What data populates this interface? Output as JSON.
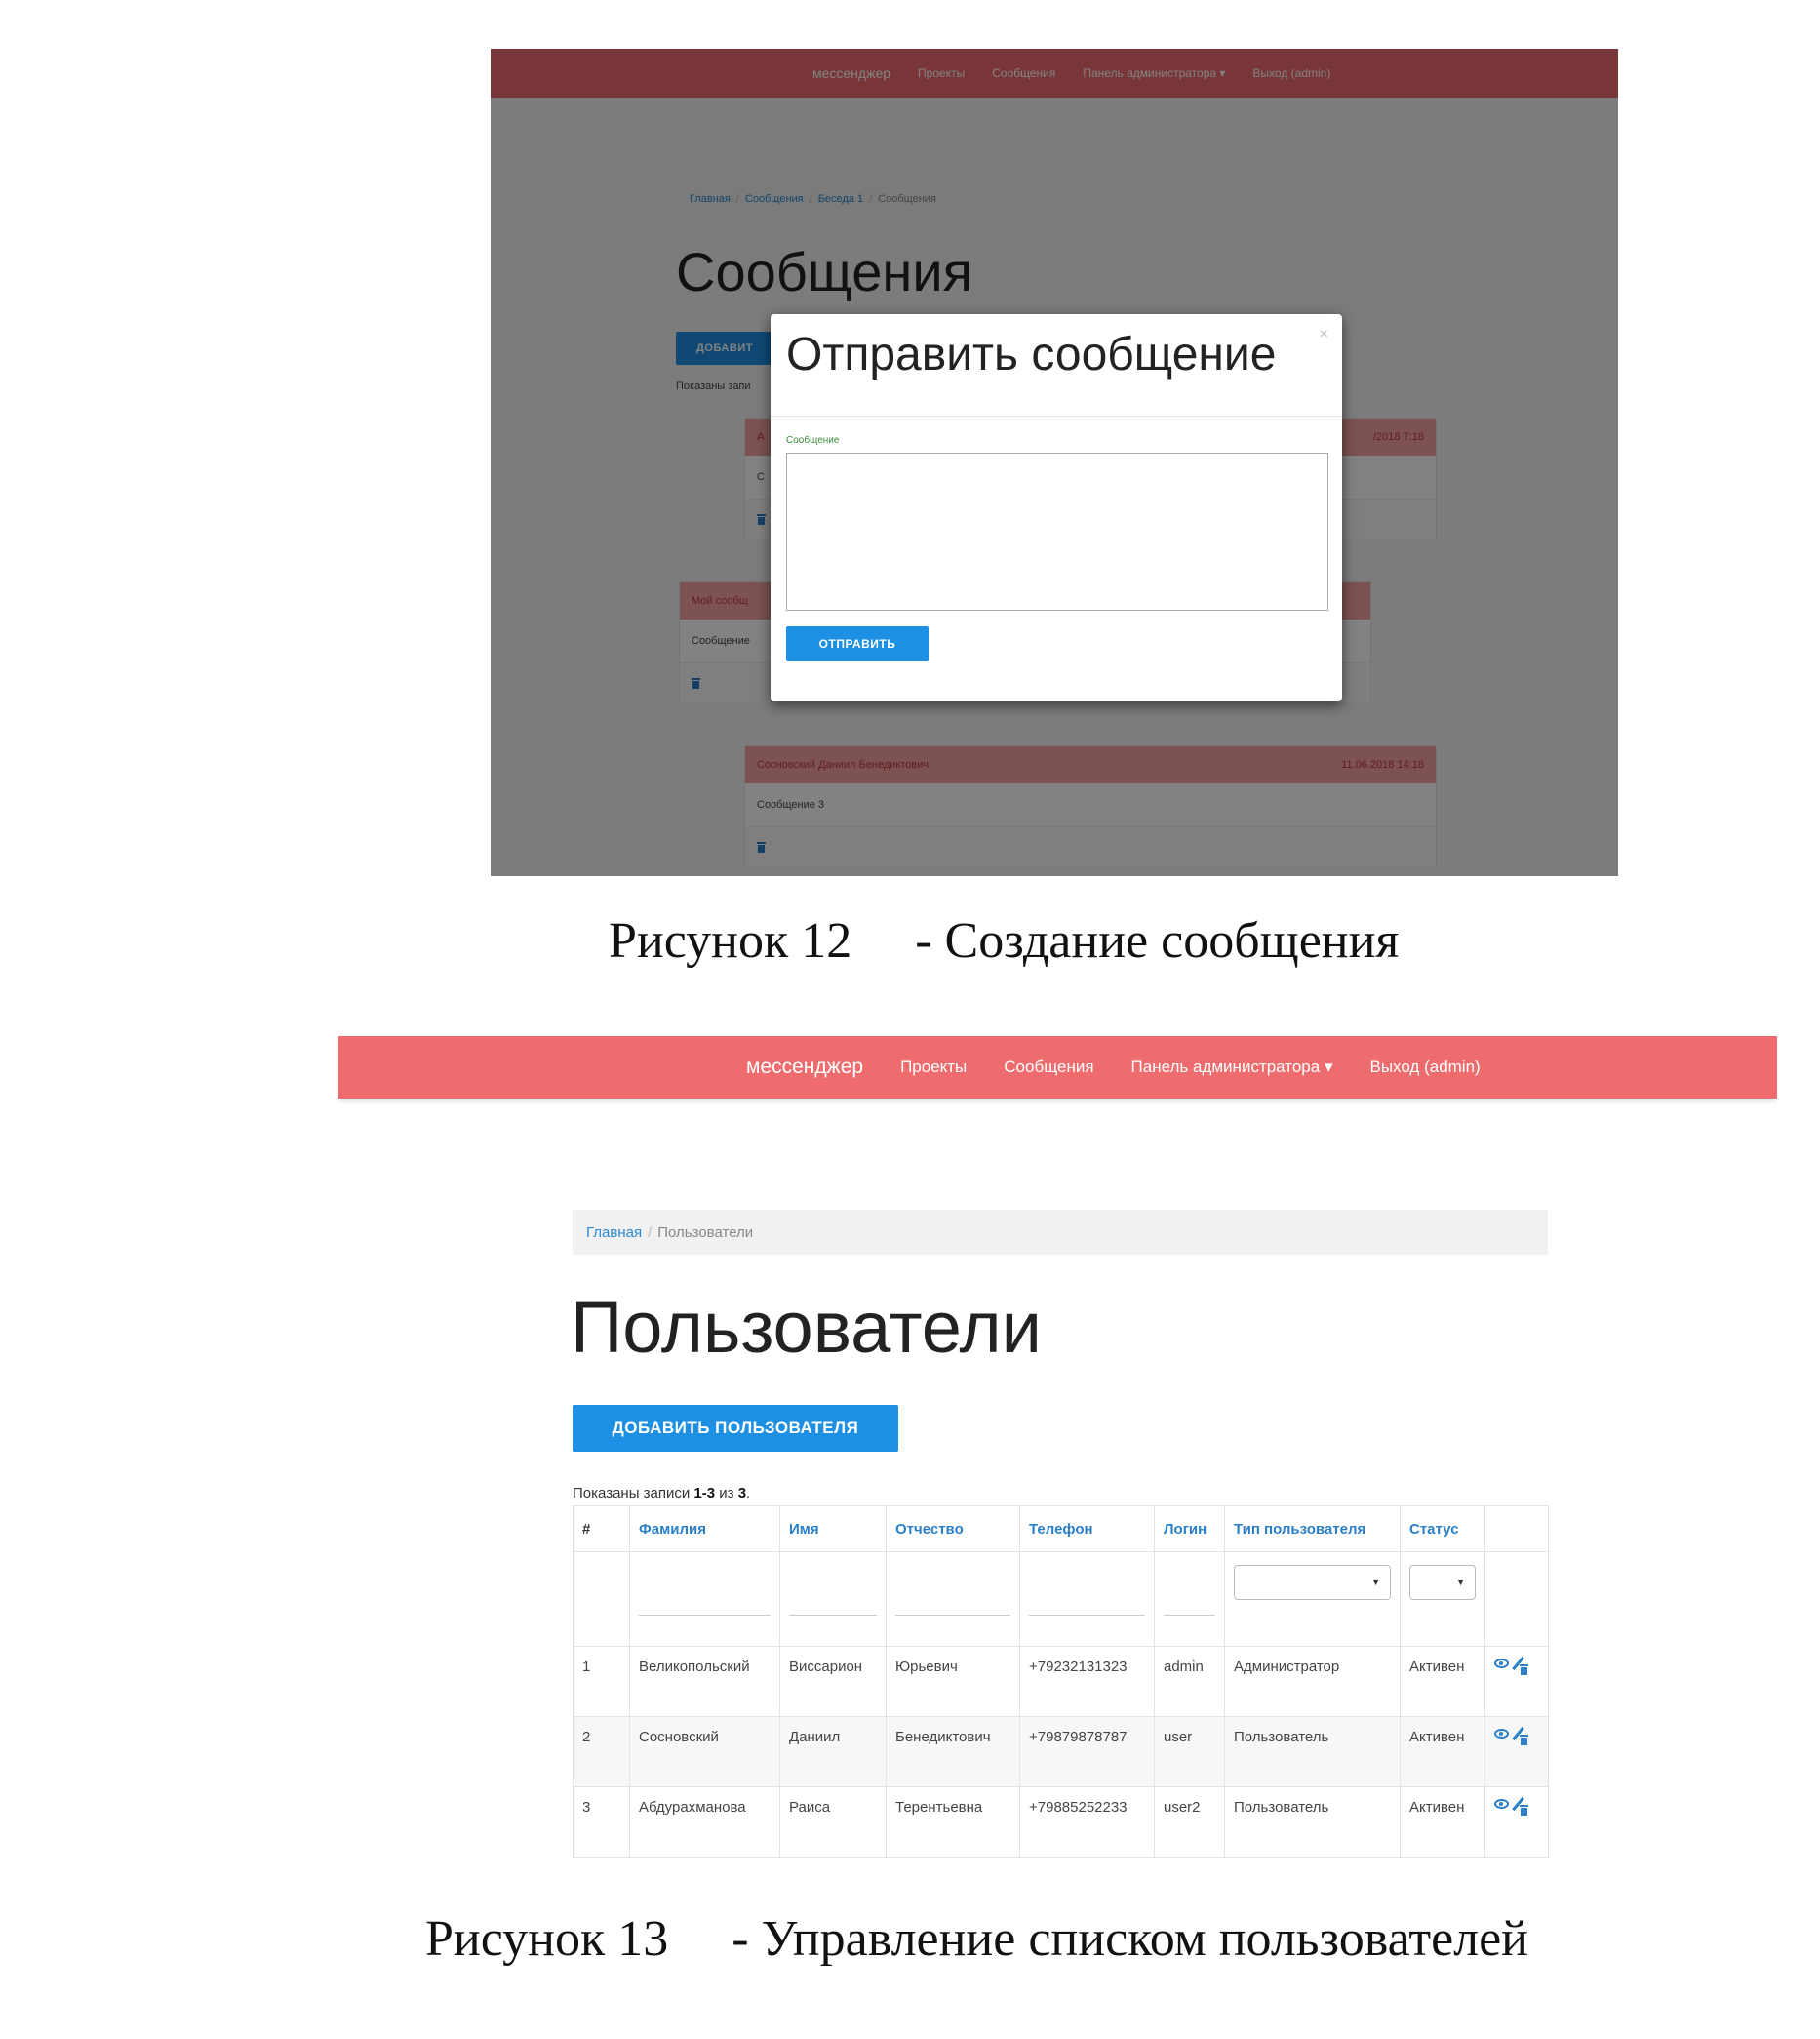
{
  "figure12": {
    "navbar": {
      "brand": "мессенджер",
      "items": [
        "Проекты",
        "Сообщения",
        "Панель администратора ▾",
        "Выход (admin)"
      ]
    },
    "breadcrumb": [
      "Главная",
      "Сообщения",
      "Беседа 1",
      "Сообщения"
    ],
    "page_title": "Сообщения",
    "add_button_label": "ДОБАВИТ",
    "summary_fragment": "Показаны запи",
    "cards": [
      {
        "head_left": "А",
        "head_right": "/2018 7:18",
        "body": "С"
      },
      {
        "head_left": "Мой сообщ",
        "head_right": "",
        "body": "Сообщение"
      },
      {
        "head_left": "Сосновский Даниил Бенедиктович",
        "head_right": "11.06.2018 14:18",
        "body": "Сообщение 3"
      }
    ],
    "modal": {
      "title": "Отправить сообщение",
      "close": "×",
      "field_label": "Сообщение",
      "submit_label": "ОТПРАВИТЬ"
    }
  },
  "caption12": {
    "label": "Рисунок",
    "number": "12",
    "text": "- Создание сообщения"
  },
  "figure13": {
    "navbar": {
      "brand": "мессенджер",
      "items": [
        "Проекты",
        "Сообщения",
        "Панель администратора ▾",
        "Выход (admin)"
      ]
    },
    "breadcrumb": {
      "home": "Главная",
      "current": "Пользователи"
    },
    "page_title": "Пользователи",
    "add_button_label": "ДОБАВИТЬ ПОЛЬЗОВАТЕЛЯ",
    "summary": {
      "prefix": "Показаны записи ",
      "range": "1-3",
      "middle": " из ",
      "total": "3",
      "suffix": "."
    },
    "table": {
      "columns": [
        "#",
        "Фамилия",
        "Имя",
        "Отчество",
        "Телефон",
        "Логин",
        "Тип пользователя",
        "Статус",
        ""
      ],
      "rows": [
        [
          "1",
          "Великопольский",
          "Виссарион",
          "Юрьевич",
          "+79232131323",
          "admin",
          "Администратор",
          "Активен"
        ],
        [
          "2",
          "Сосновский",
          "Даниил",
          "Бенедиктович",
          "+79879878787",
          "user",
          "Пользователь",
          "Активен"
        ],
        [
          "3",
          "Абдурахманова",
          "Раиса",
          "Терентьевна",
          "+79885252233",
          "user2",
          "Пользователь",
          "Активен"
        ]
      ]
    }
  },
  "caption13": {
    "label": "Рисунок",
    "number": "13",
    "text": "- Управление списком пользователей"
  },
  "colors": {
    "navbar": "#ee6b6e",
    "primary_button": "#1e90e3",
    "link": "#2a7fc9"
  }
}
